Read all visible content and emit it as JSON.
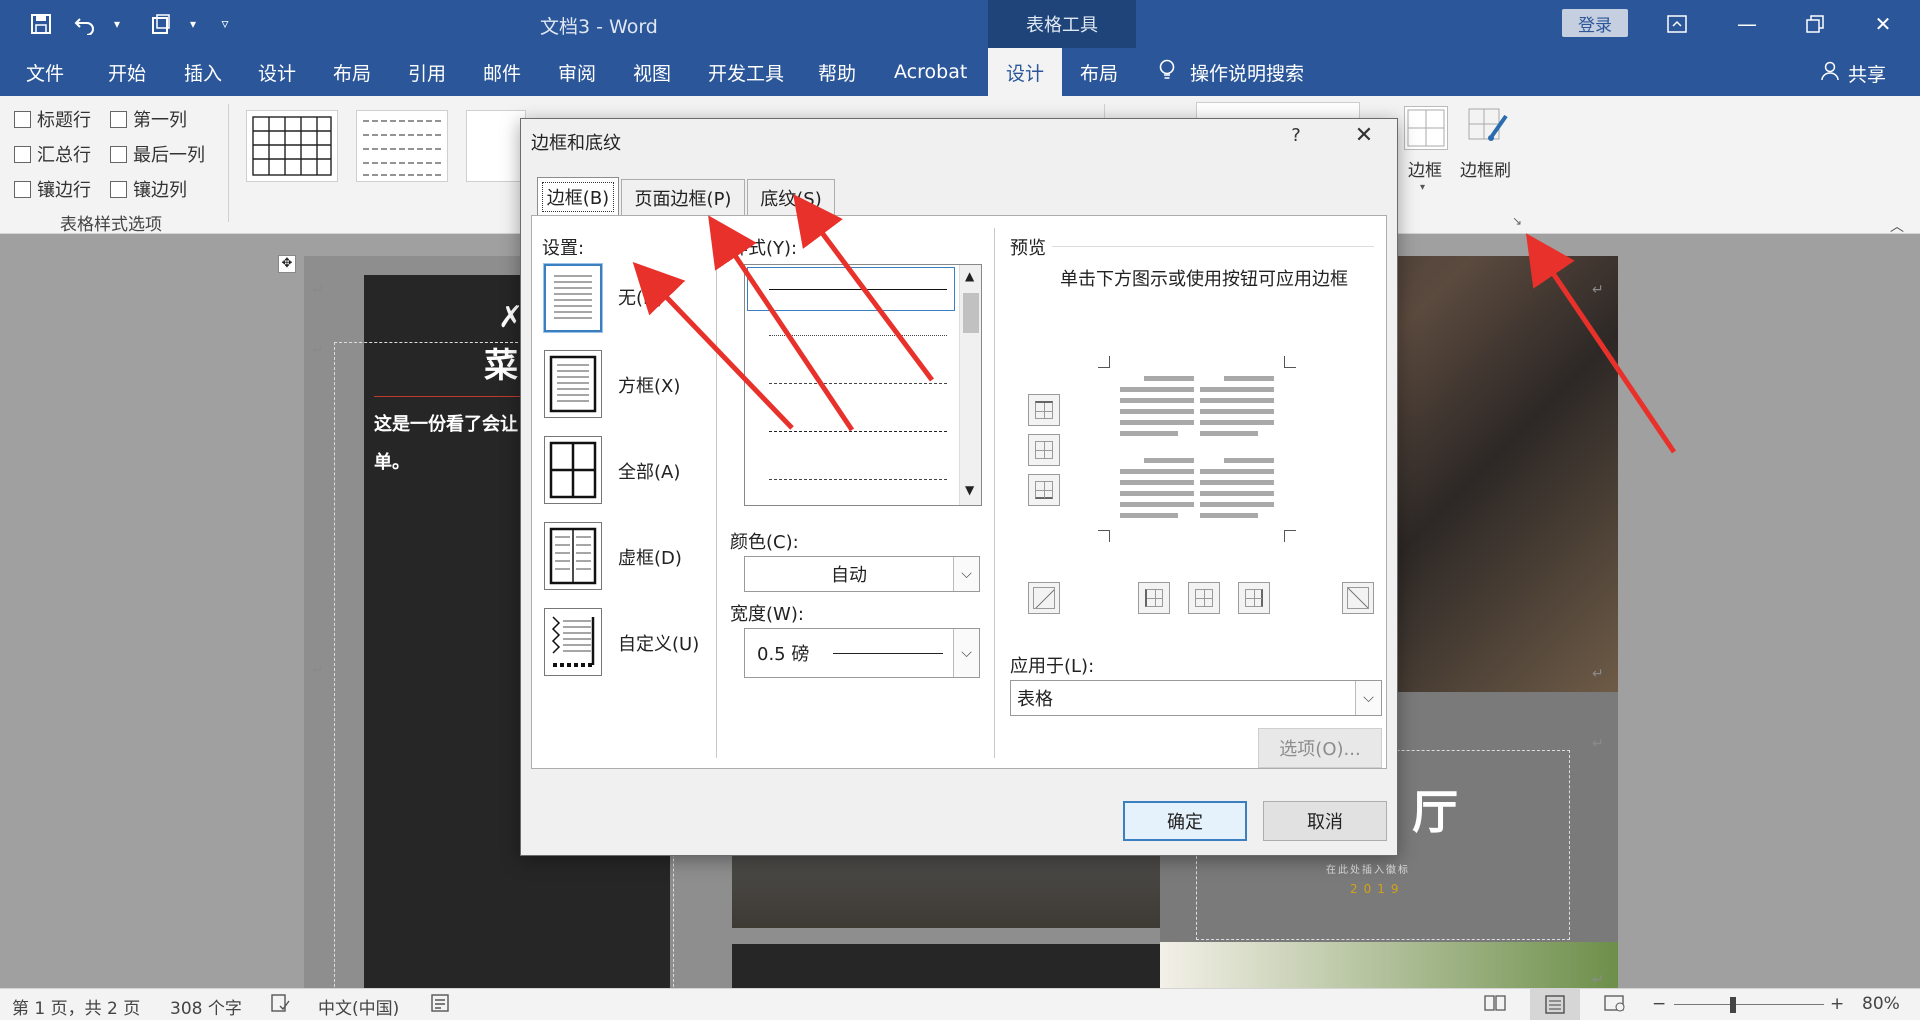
{
  "window": {
    "title": "文档3  -  Word",
    "context_tools": "表格工具",
    "login": "登录"
  },
  "ribbon_tabs": [
    "文件",
    "开始",
    "插入",
    "设计",
    "布局",
    "引用",
    "邮件",
    "审阅",
    "视图",
    "开发工具",
    "帮助",
    "Acrobat",
    "设计",
    "布局"
  ],
  "search_label": "操作说明搜索",
  "share_label": "共享",
  "style_options": {
    "items": [
      "标题行",
      "第一列",
      "汇总行",
      "最后一列",
      "镶边行",
      "镶边列"
    ],
    "group_label": "表格样式选项"
  },
  "border_buttons": {
    "borders": "边框",
    "painter": "边框刷"
  },
  "document": {
    "menu_title": "菜",
    "menu_desc_line1": "这是一份看了会让",
    "menu_desc_line2": "单。",
    "restaurant_glyph": "厅",
    "logo_hint": "在此处插入徽标",
    "year": "2019"
  },
  "status": {
    "page": "第 1 页，共 2 页",
    "words": "308 个字",
    "language": "中文(中国)",
    "zoom": "80%"
  },
  "dialog": {
    "title": "边框和底纹",
    "help": "?",
    "tabs": [
      "边框(B)",
      "页面边框(P)",
      "底纹(S)"
    ],
    "settings_label": "设置:",
    "settings": [
      "无(N)",
      "方框(X)",
      "全部(A)",
      "虚框(D)",
      "自定义(U)"
    ],
    "style_label": "样式(Y):",
    "color_label": "颜色(C):",
    "color_value": "自动",
    "width_label": "宽度(W):",
    "width_value": "0.5 磅",
    "preview_label": "预览",
    "preview_hint": "单击下方图示或使用按钮可应用边框",
    "apply_label": "应用于(L):",
    "apply_value": "表格",
    "options_button": "选项(O)...",
    "ok_button": "确定",
    "cancel_button": "取消"
  },
  "colors": {
    "title_bar": "#2b579a",
    "context_tab": "#1e4479",
    "annotation_arrow": "#e8312a"
  }
}
